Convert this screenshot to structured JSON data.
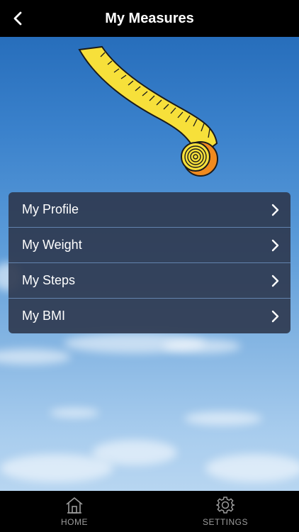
{
  "header": {
    "title": "My Measures"
  },
  "menu": {
    "items": [
      {
        "label": "My Profile"
      },
      {
        "label": "My Weight"
      },
      {
        "label": "My Steps"
      },
      {
        "label": "My BMI"
      }
    ]
  },
  "tabbar": {
    "home_label": "HOME",
    "settings_label": "SETTINGS"
  },
  "colors": {
    "header_bg": "#000000",
    "tape_yellow": "#f7e03a",
    "tape_orange": "#f08a1e",
    "menu_bg": "#2d374e"
  },
  "icons": {
    "back": "chevron-left-icon",
    "home": "home-icon",
    "settings": "gear-icon",
    "row_chevron": "chevron-right-icon"
  }
}
